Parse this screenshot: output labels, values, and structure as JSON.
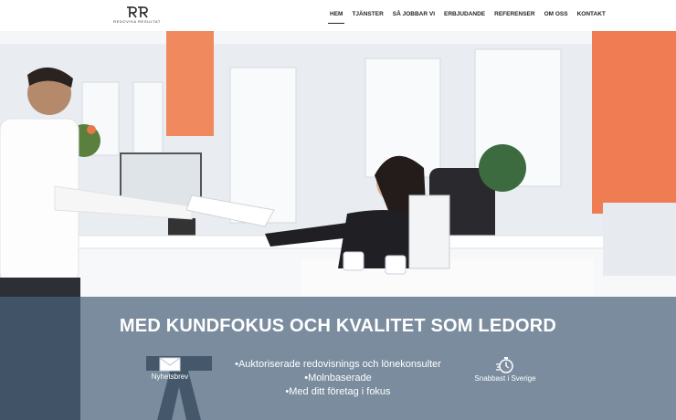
{
  "logo": {
    "name": "REDOVISA RESULTAT"
  },
  "nav": [
    {
      "label": "HEM",
      "active": true
    },
    {
      "label": "TJÄNSTER"
    },
    {
      "label": "SÅ JOBBAR VI"
    },
    {
      "label": "ERBJUDANDE"
    },
    {
      "label": "REFERENSER"
    },
    {
      "label": "OM OSS"
    },
    {
      "label": "KONTAKT"
    }
  ],
  "hero": {
    "headline": "MED KUNDFOKUS OCH KVALITET SOM LEDORD",
    "features": [
      "•Auktoriserade redovisnings och lönekonsulter",
      "•Molnbaserade",
      "•Med ditt företag i fokus"
    ],
    "newsletter_label": "Nyhetsbrev",
    "fast_label": "Snabbast i Sverige"
  },
  "colors": {
    "band": "#4a627a",
    "accent_wall": "#ef7c52",
    "text_light": "#ffffff"
  },
  "icons": {
    "newsletter": "envelope-icon",
    "fast": "stopwatch-icon"
  }
}
